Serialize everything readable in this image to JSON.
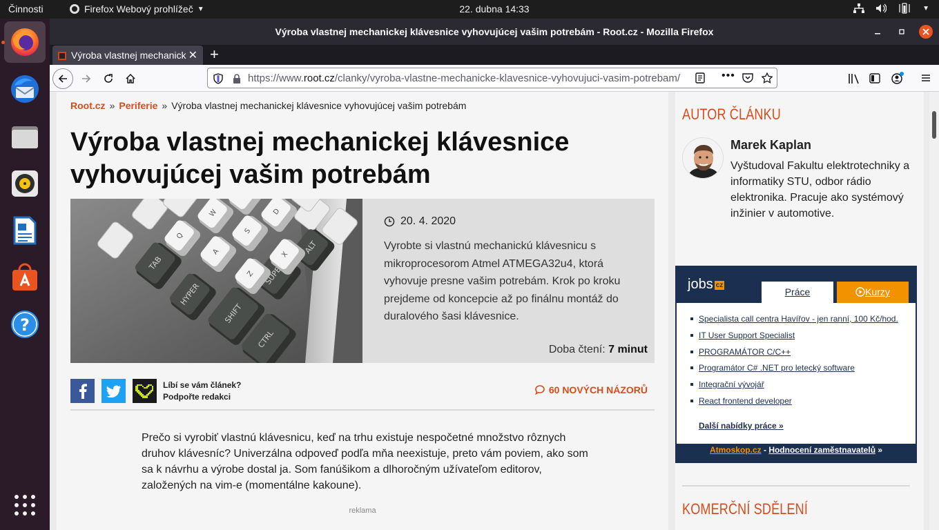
{
  "os": {
    "activities": "Činnosti",
    "app_menu": "Firefox Webový prohlížeč",
    "clock": "22. dubna  14:33"
  },
  "window": {
    "title": "Výroba vlastnej mechanickej klávesnice vyhovujúcej vašim potrebám - Root.cz - Mozilla Firefox"
  },
  "tab": {
    "title": "Výroba vlastnej mechanick",
    "close": "✕",
    "new_tab": "+"
  },
  "urlbar": {
    "prefix": "https://www.",
    "domain": "root.cz",
    "path": "/clanky/vyroba-vlastne-mechanicke-klavesnice-vyhovujuci-vasim-potrebam/"
  },
  "breadcrumb": {
    "items": [
      "Root.cz",
      "Periferie"
    ],
    "sep": "»",
    "current": "Výroba vlastnej mechanickej klávesnice vyhovujúcej vašim potrebám"
  },
  "article": {
    "title": "Výroba vlastnej mechanickej klávesnice vyhovujúcej vašim potrebám",
    "date": "20. 4. 2020",
    "perex": "Vyrobte si vlastnú mechanickú klávesnicu s mikroprocesorom Atmel ATMEGA32u4, ktorá vyhovuje presne vašim potrebám. Krok po kroku prejdeme od koncepcie až po finálnu montáž do duralového šasi klávesnice.",
    "read_time_label": "Doba čtení:",
    "read_time_value": "7 minut",
    "support_line1": "Líbí se vám článek?",
    "support_line2": "Podpořte redakci",
    "comments": "60 NOVÝCH NÁZORŮ",
    "body": "Prečo si vyrobiť vlastnú klávesnicu, keď na trhu existuje nespočetné množstvo rôznych druhov klávesníc? Univerzálna odpoveď podľa mňa neexistuje, preto vám poviem, ako som sa k návrhu a výrobe dostal ja. Som fanúšikom a dlhoročným užívateľom editorov, založených na vim-e (momentálne kakoune).",
    "ad_label": "reklama",
    "keycaps": [
      "TAB",
      "HYPER",
      "SHIFT",
      "SUPER",
      "ALT",
      "CTRL",
      "Q",
      "W",
      "E",
      "A",
      "S",
      "D",
      "Z",
      "X"
    ]
  },
  "sidebar": {
    "author_heading": "AUTOR ČLÁNKU",
    "author_name": "Marek Kaplan",
    "author_bio": "Vyštudoval Fakultu elektrotechniky a informatiky STU, odbor rádio elektronika. Pracuje ako systémový inžinier v automotive.",
    "jobs": {
      "logo": "jobs",
      "logo_suffix": "cz",
      "tab_prace": "Práce",
      "tab_kurzy": "Kurzy",
      "items": [
        "Specialista call centra Havířov - jen ranní, 100 Kč/hod.",
        "IT User Support Specialist",
        "PROGRAMÁTOR C/C++",
        "Programátor C# .NET pro letecký software",
        "Integrační vývojář",
        "React frontend developer"
      ],
      "more": "Další nabídky práce »",
      "footer_left": "Atmoskop.cz",
      "footer_dash": " - ",
      "footer_right": "Hodnocení zaměstnavatelů",
      "footer_arrow": " »"
    },
    "commercial_heading": "KOMERČNÍ SDĚLENÍ"
  },
  "colors": {
    "accent": "#d94c1a",
    "jobs_navy": "#1b3050",
    "jobs_orange": "#f39200",
    "facebook": "#3b5998",
    "twitter": "#1da1f2"
  }
}
